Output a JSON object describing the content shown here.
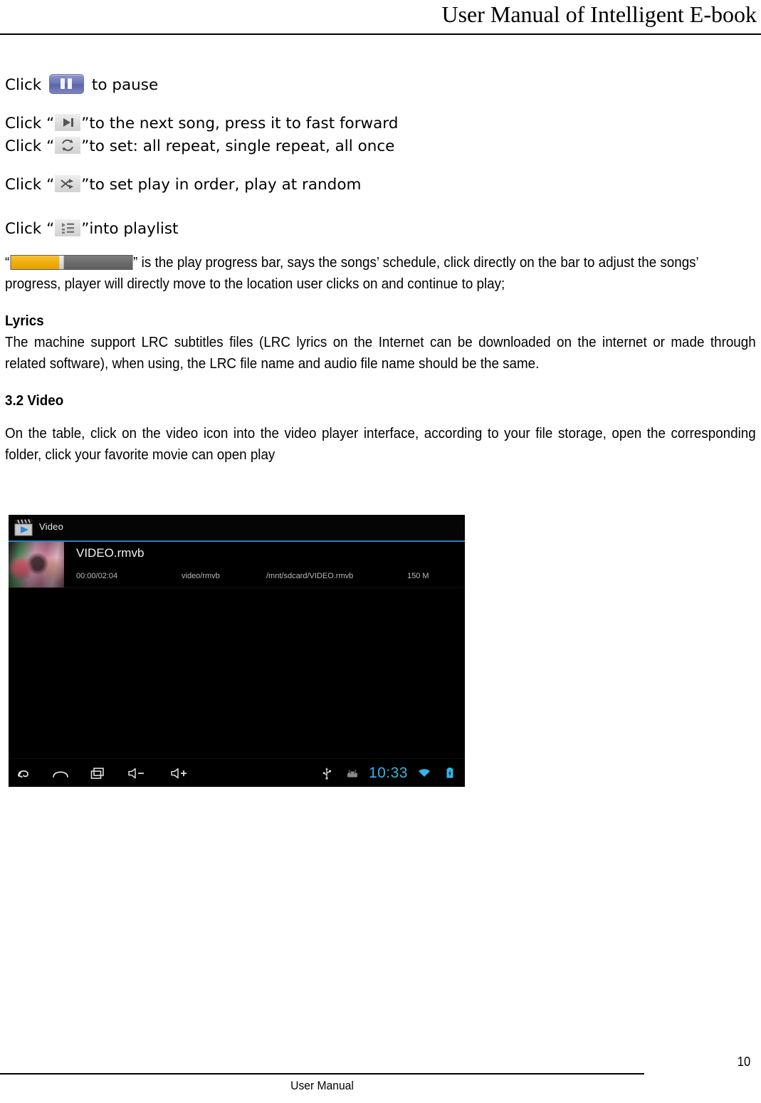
{
  "document": {
    "header_title": "User Manual of Intelligent E-book",
    "footer_label": "User Manual",
    "page_number": "10"
  },
  "instructions": {
    "pause": {
      "prefix": "Click",
      "suffix": "to pause",
      "icon": "pause-icon"
    },
    "next": {
      "prefix": "Click “",
      "suffix": "”to the next song, press it to fast forward",
      "icon": "next-track-icon"
    },
    "repeat": {
      "prefix": "Click “",
      "suffix": "”to set: all repeat, single repeat, all once",
      "icon": "repeat-icon"
    },
    "shuffle": {
      "prefix": "Click “",
      "suffix": "”to set play in order, play at random",
      "icon": "shuffle-icon"
    },
    "playlist": {
      "prefix": "Click “",
      "suffix": "”into playlist",
      "icon": "playlist-icon"
    },
    "progress": {
      "open_quote": "“",
      "close_quote": "”",
      "text": " is the play progress bar, says the songs’ schedule, click directly on the bar to adjust the songs’ progress, player will directly move to the location user clicks on and continue to play;",
      "fill_percent": 40,
      "fill_color": "#f0ad0b",
      "track_color": "#6a6a6a"
    }
  },
  "lyrics_section": {
    "heading": "Lyrics",
    "body": "The machine support LRC subtitles files (LRC lyrics on the Internet can be downloaded on the internet or made through related software), when using, the LRC file name and audio file name should be the same."
  },
  "video_section": {
    "heading": "3.2 Video",
    "body": "On the table, click on the video icon into the video player interface, according to your file storage, open the corresponding folder, click your favorite movie can open play"
  },
  "video_player": {
    "app_icon": "clapperboard-icon",
    "app_label": "Video",
    "accent_color": "#2a7fbf",
    "item": {
      "title": "VIDEO.rmvb",
      "duration": "00:00/02:04",
      "mime": "video/rmvb",
      "path": "/mnt/sdcard/VIDEO.rmvb",
      "size": "150 M"
    },
    "navbar": {
      "back": "back-icon",
      "home": "home-icon",
      "recents": "recents-icon",
      "volume_down": "volume-down-icon",
      "volume_up": "volume-up-icon",
      "usb": "usb-icon",
      "android": "android-robot-icon",
      "clock": "10:33",
      "clock_color": "#33b5e5",
      "wifi": "wifi-icon",
      "battery": "battery-icon"
    }
  }
}
